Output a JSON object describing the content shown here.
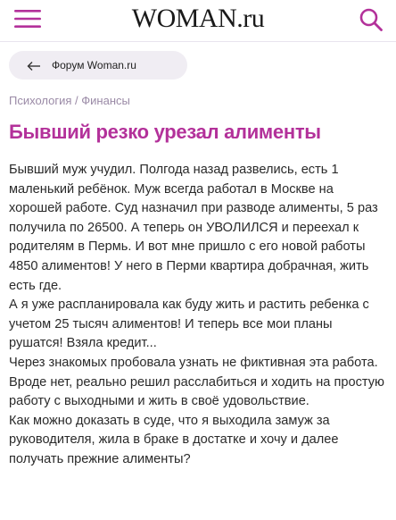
{
  "header": {
    "logo": "WOMAN.ru",
    "menu_icon": "hamburger-menu-icon",
    "search_icon": "search-icon",
    "accent_color": "#b3319a"
  },
  "forum_link": {
    "label": "Форум Woman.ru",
    "icon": "arrow-left-icon"
  },
  "breadcrumb": {
    "category": "Психология",
    "separator": " / ",
    "subcategory": "Финансы"
  },
  "post": {
    "title": "Бывший резко урезал алименты",
    "paragraphs": [
      "Бывший муж учудил. Полгода назад развелись, есть 1 маленький ребёнок. Муж всегда работал в Москве на хорошей работе. Суд назначил при разводе алименты, 5 раз получила по 26500. А теперь он УВОЛИЛСЯ и переехал к родителям в Пермь. И вот мне пришло с его новой работы 4850 алиментов! У него в Перми квартира добрачная, жить есть где.",
      "А я уже распланировала как буду жить и растить ребенка с учетом 25 тысяч алиментов! И теперь все мои планы рушатся! Взяла кредит...",
      "Через знакомых пробовала узнать не фиктивная эта работа. Вроде нет, реально решил расслабиться и ходить на простую работу с выходными и жить в своё удовольствие.",
      "Как можно доказать в суде, что я выходила замуж за руководителя, жила в браке в достатке и хочу и далее получать прежние алименты?"
    ]
  }
}
